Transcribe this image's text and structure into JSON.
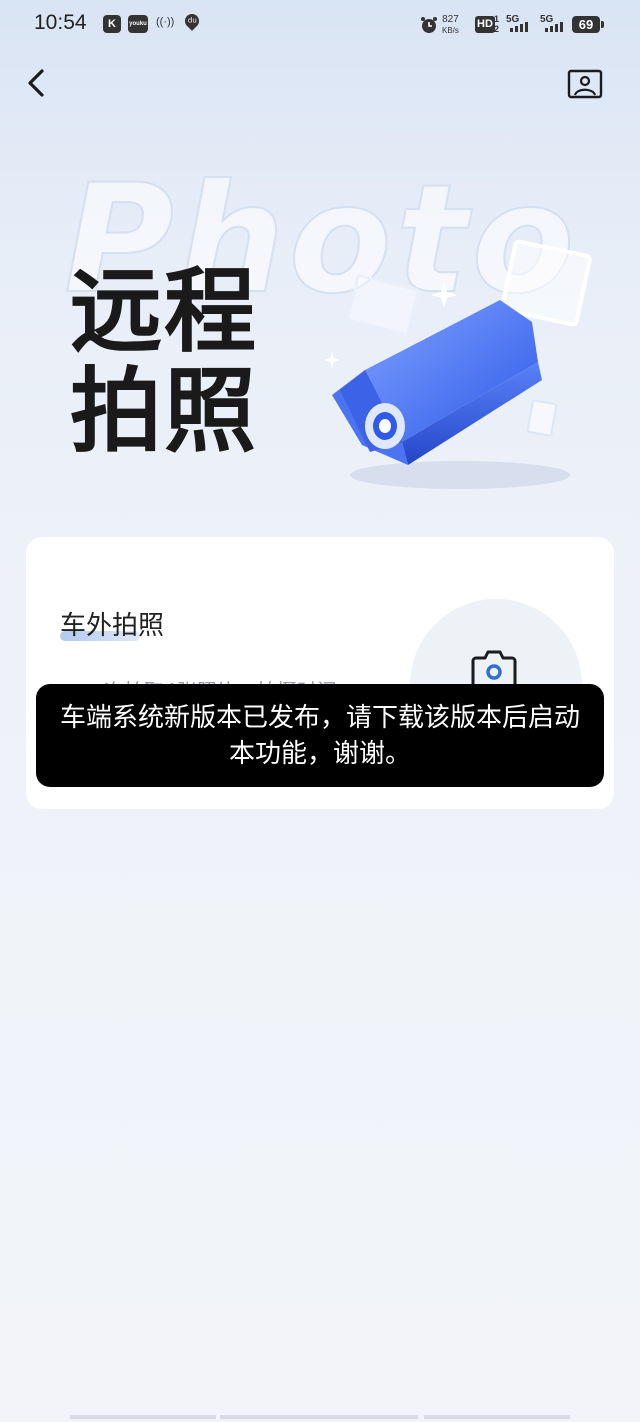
{
  "status_bar": {
    "time": "10:54",
    "app_icon_1": "K",
    "app_icon_2": "youku",
    "app_icon_3": "((·))",
    "app_icon_4": "du",
    "net_speed_value": "827",
    "net_speed_unit": "KB/s",
    "hd_label": "HD",
    "sim1_label": "5G",
    "sim2_label": "5G",
    "battery": "69"
  },
  "header": {
    "back_icon": "chevron-left-icon",
    "album_icon": "photo-album-icon"
  },
  "hero": {
    "watermark": "Photo",
    "title_line1": "远程",
    "title_line2": "拍照"
  },
  "card": {
    "title": "车外拍照",
    "description": "一次拍取4张照片，拍摄时间",
    "camera_icon": "camera-icon"
  },
  "toast": {
    "message": "车端系统新版本已发布，请下载该版本后启动本功能，谢谢。"
  },
  "colors": {
    "accent_blue": "#3f6ff0",
    "toast_bg": "#000000",
    "card_bg": "#ffffff"
  }
}
